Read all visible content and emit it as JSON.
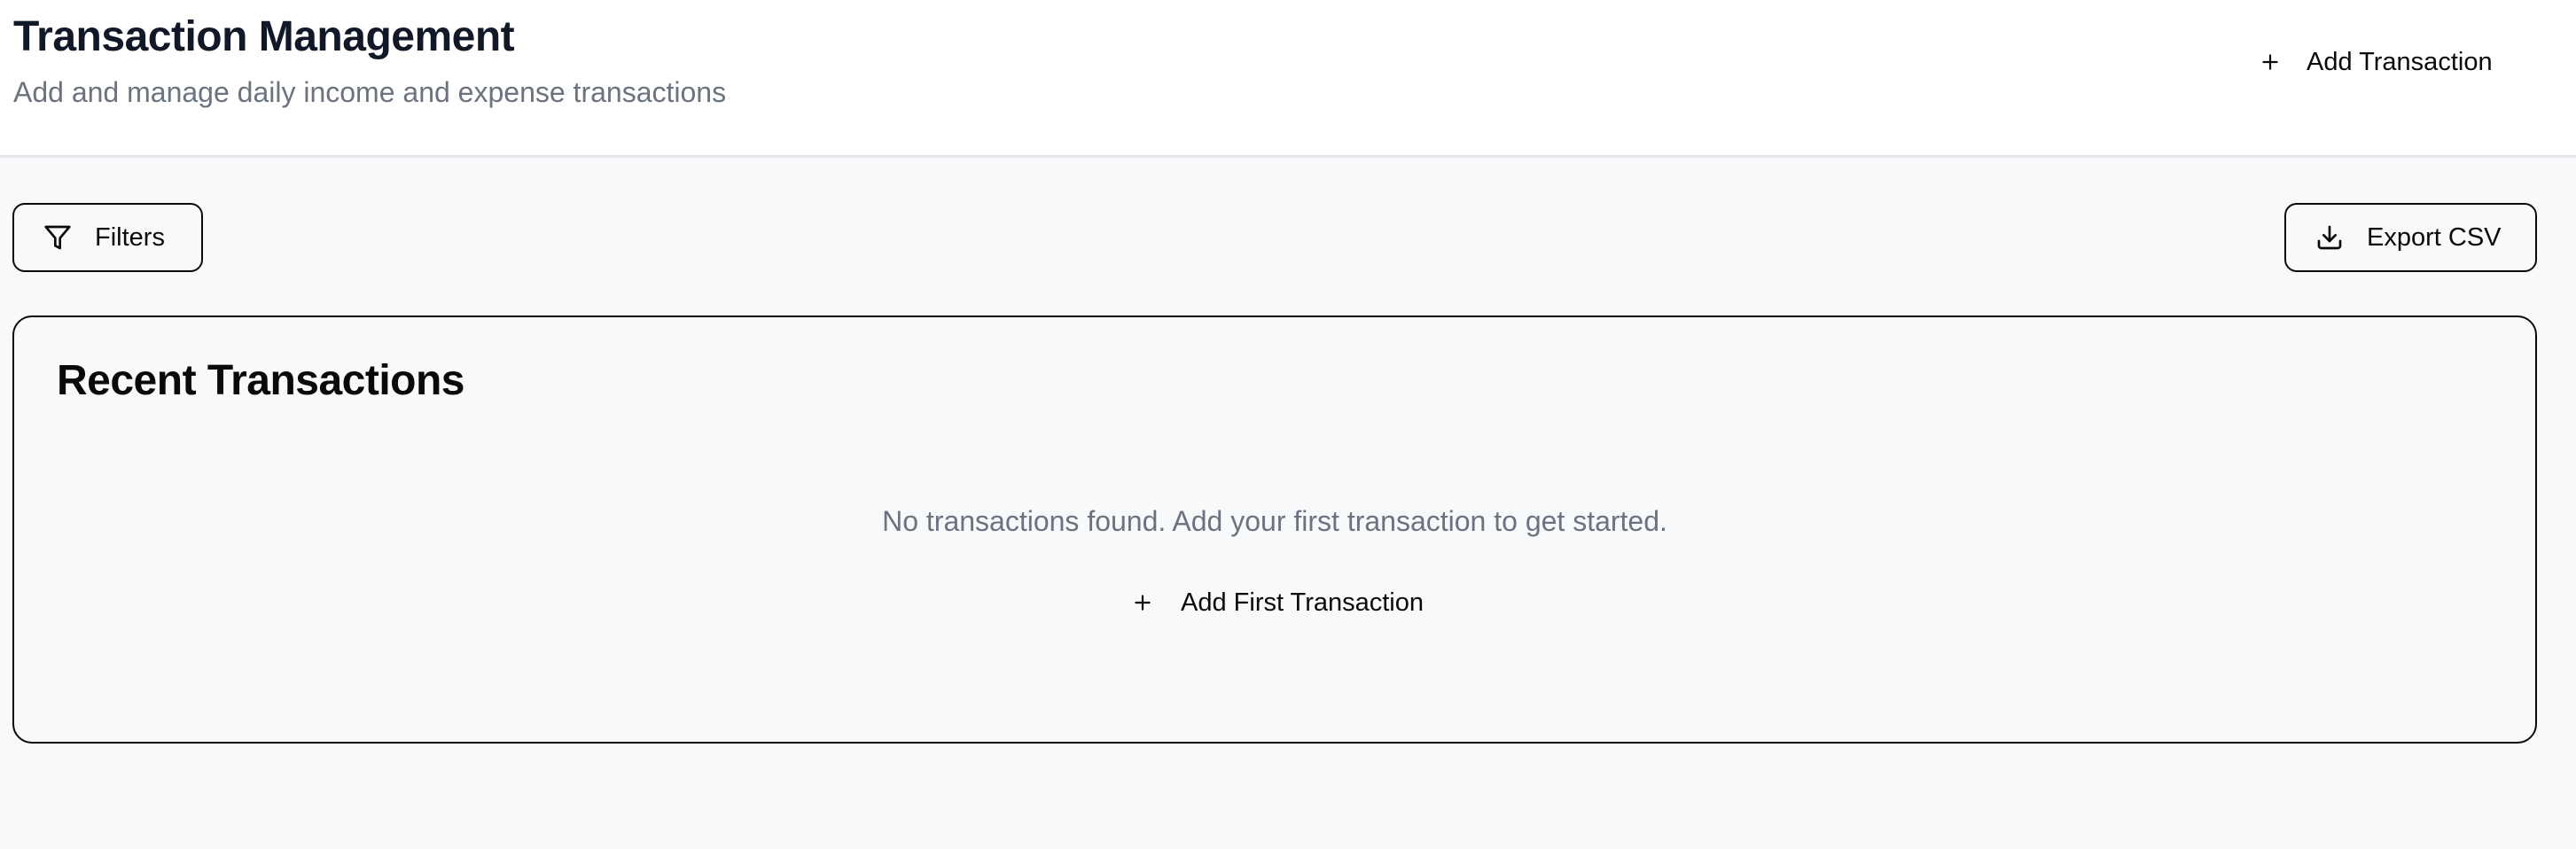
{
  "header": {
    "title": "Transaction Management",
    "subtitle": "Add and manage daily income and expense transactions",
    "add_button_label": "Add Transaction",
    "add_button_icon": "plus-icon"
  },
  "toolbar": {
    "filters_label": "Filters",
    "filters_icon": "filter-icon",
    "export_label": "Export CSV",
    "export_icon": "download-icon"
  },
  "transactions_card": {
    "title": "Recent Transactions",
    "empty_message": "No transactions found. Add your first transaction to get started.",
    "add_first_label": "Add First Transaction",
    "add_first_icon": "plus-icon",
    "items": []
  },
  "colors": {
    "page_background": "#f8f9fb",
    "header_background": "#ffffff",
    "title_text": "#111827",
    "muted_text": "#6b7280",
    "border": "#0a0a0a"
  }
}
